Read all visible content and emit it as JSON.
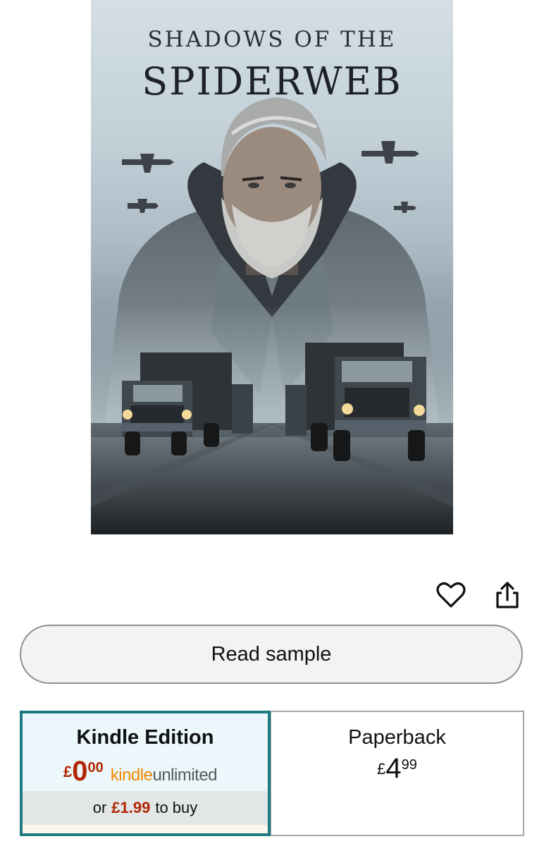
{
  "cover": {
    "title_line1": "SHADOWS OF THE",
    "title_line2": "SPIDERWEB"
  },
  "actions": {
    "wishlist_icon": "heart-icon",
    "share_icon": "share-icon"
  },
  "read_sample": {
    "label": "Read sample"
  },
  "formats": [
    {
      "name": "Kindle Edition",
      "price_currency": "£",
      "price_main": "0",
      "price_fraction": "00",
      "subscription_logo_part1": "kindle",
      "subscription_logo_part2": "unlimited",
      "buy_prefix": "or",
      "buy_price": "£1.99",
      "buy_suffix": "to buy",
      "selected": true
    },
    {
      "name": "Paperback",
      "price_currency": "£",
      "price_main": "4",
      "price_fraction": "99",
      "selected": false
    }
  ],
  "colors": {
    "price_red": "#b12704",
    "selected_border": "#1d7a80",
    "kindle_orange": "#f08804"
  }
}
